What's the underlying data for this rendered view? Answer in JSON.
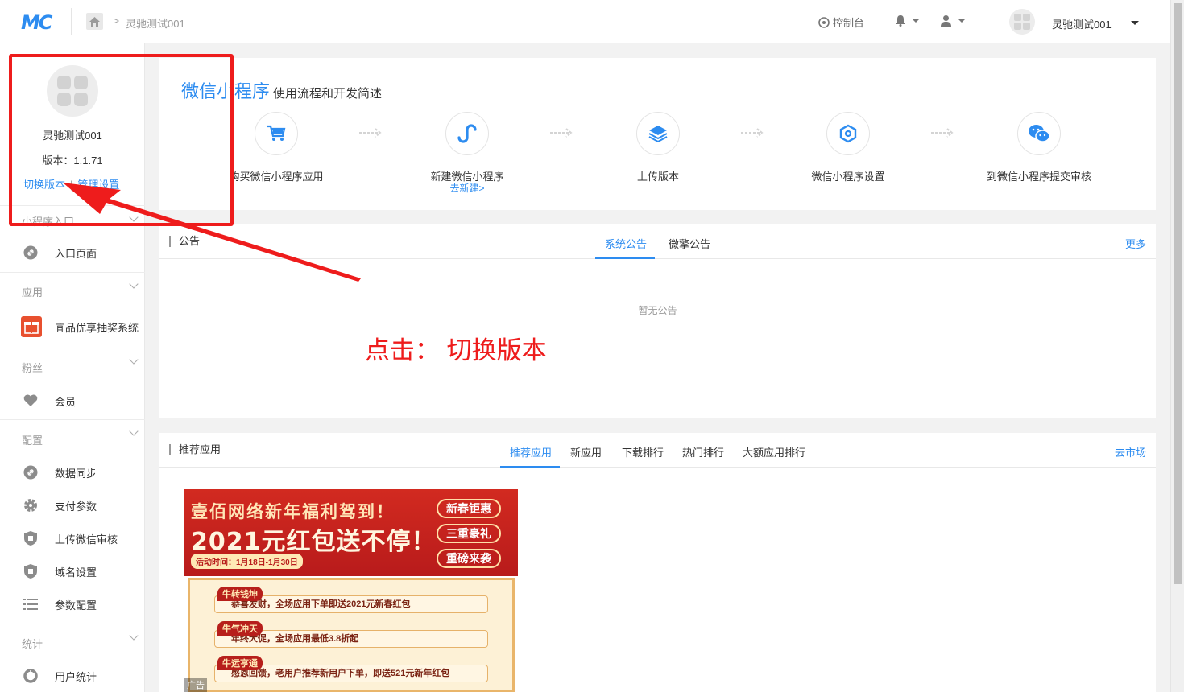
{
  "header": {
    "logo": "MC",
    "breadcrumb": "灵驰测试001",
    "console": "控制台",
    "username": "灵驰测试001"
  },
  "sidebar": {
    "name": "灵驰测试001",
    "version": "版本：1.1.71",
    "switch_version": "切换版本",
    "manage_settings": "管理设置",
    "groups": [
      {
        "label": "小程序入口",
        "items": [
          {
            "label": "入口页面",
            "icon": "link-icon"
          }
        ]
      },
      {
        "label": "应用",
        "items": [
          {
            "label": "宜品优享抽奖系统",
            "icon": "gift-icon"
          }
        ]
      },
      {
        "label": "粉丝",
        "items": [
          {
            "label": "会员",
            "icon": "heart-icon"
          }
        ]
      },
      {
        "label": "配置",
        "items": [
          {
            "label": "数据同步",
            "icon": "link-icon"
          },
          {
            "label": "支付参数",
            "icon": "gear-icon"
          },
          {
            "label": "上传微信审核",
            "icon": "shield-icon"
          },
          {
            "label": "域名设置",
            "icon": "shield-icon"
          },
          {
            "label": "参数配置",
            "icon": "list-icon"
          }
        ]
      },
      {
        "label": "统计",
        "items": [
          {
            "label": "用户统计",
            "icon": "chart-icon"
          }
        ]
      }
    ]
  },
  "flow": {
    "title": "微信小程序",
    "subtitle": "使用流程和开发简述",
    "steps": [
      {
        "label": "购买微信小程序应用",
        "icon": "cart-icon"
      },
      {
        "label": "新建微信小程序",
        "sub": "去新建>",
        "icon": "miniprogram-icon"
      },
      {
        "label": "上传版本",
        "icon": "layers-icon"
      },
      {
        "label": "微信小程序设置",
        "icon": "hexagon-icon"
      },
      {
        "label": "到微信小程序提交审核",
        "icon": "wechat-icon"
      }
    ]
  },
  "announcements": {
    "title": "公告",
    "tabs": [
      "系统公告",
      "微擎公告"
    ],
    "more": "更多",
    "empty": "暂无公告"
  },
  "recommend": {
    "title": "推荐应用",
    "tabs": [
      "推荐应用",
      "新应用",
      "下载排行",
      "热门排行",
      "大额应用排行"
    ],
    "market": "去市场"
  },
  "ad": {
    "line1": "壹佰网络新年福利驾到！",
    "line2": "2021元红包送不停！",
    "date": "活动时间：1月18日-1月30日",
    "pills": [
      "新春钜惠",
      "三重豪礼",
      "重磅来袭"
    ],
    "rows": [
      {
        "tag": "牛转钱坤",
        "text": "恭喜发财，全场应用下单即送2021元新春红包"
      },
      {
        "tag": "牛气冲天",
        "text": "年终大促，全场应用最低3.8折起"
      },
      {
        "tag": "牛运亨通",
        "text": "感恩回馈，老用户推荐新用户下单，即送521元新年红包"
      }
    ],
    "label": "广告"
  },
  "annotation": {
    "instruction": "点击：  切换版本"
  },
  "colors": {
    "accent": "#2d8cf0",
    "annotation": "#ee1c1c"
  }
}
